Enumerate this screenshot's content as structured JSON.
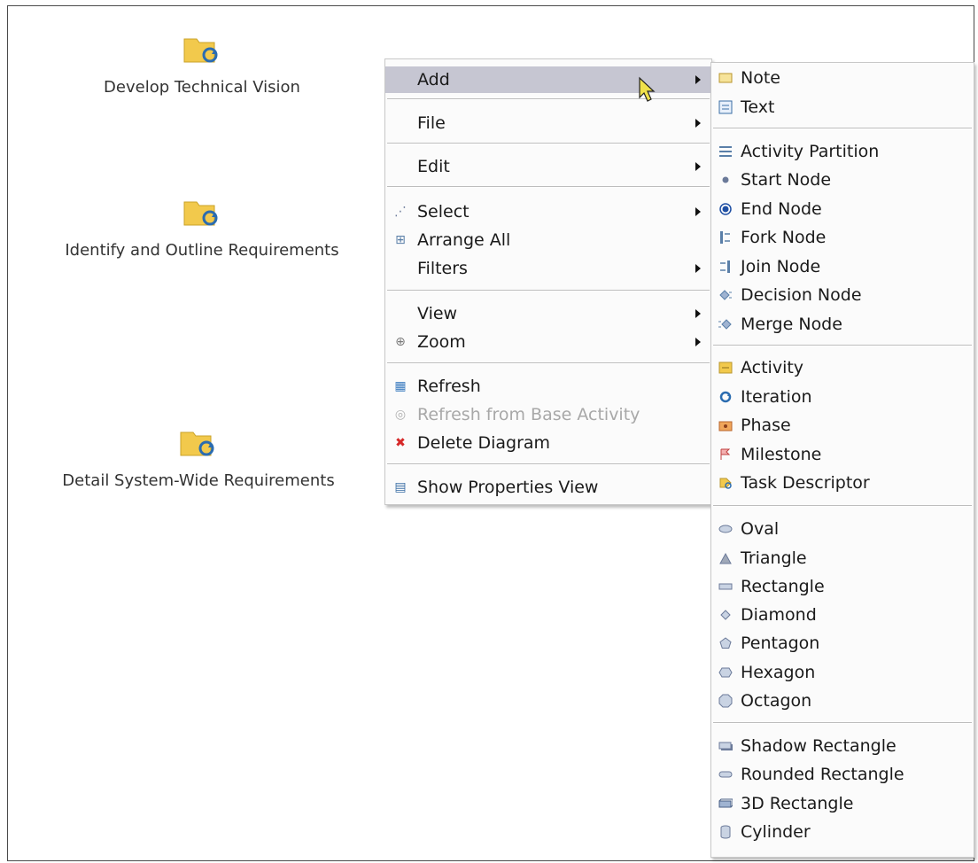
{
  "diagram": {
    "nodes": [
      {
        "label": "Develop Technical Vision",
        "icon": "activity-folder-icon"
      },
      {
        "label": "Identify and Outline Requirements",
        "icon": "activity-folder-icon"
      },
      {
        "label": "Detail System-Wide Requirements",
        "icon": "activity-folder-icon"
      }
    ]
  },
  "context_menu": {
    "items": [
      {
        "label": "Add",
        "icon": "",
        "submenu": true,
        "highlighted": true
      },
      {
        "label": "File",
        "icon": "",
        "submenu": true
      },
      {
        "label": "Edit",
        "icon": "",
        "submenu": true
      },
      {
        "label": "Select",
        "icon": "select-icon",
        "submenu": true
      },
      {
        "label": "Arrange All",
        "icon": "arrange-icon",
        "submenu": false
      },
      {
        "label": "Filters",
        "icon": "",
        "submenu": true
      },
      {
        "label": "View",
        "icon": "",
        "submenu": true
      },
      {
        "label": "Zoom",
        "icon": "zoom-icon",
        "submenu": true
      },
      {
        "label": "Refresh",
        "icon": "refresh-icon",
        "submenu": false
      },
      {
        "label": "Refresh from Base Activity",
        "icon": "refresh-base-icon",
        "submenu": false,
        "disabled": true
      },
      {
        "label": "Delete Diagram",
        "icon": "delete-icon",
        "submenu": false
      },
      {
        "label": "Show Properties View",
        "icon": "properties-icon",
        "submenu": false
      }
    ]
  },
  "add_submenu": {
    "items": [
      {
        "label": "Note",
        "icon": "note-icon"
      },
      {
        "label": "Text",
        "icon": "text-icon"
      },
      {
        "label": "Activity Partition",
        "icon": "partition-icon"
      },
      {
        "label": "Start Node",
        "icon": "start-node-icon"
      },
      {
        "label": "End Node",
        "icon": "end-node-icon"
      },
      {
        "label": "Fork Node",
        "icon": "fork-node-icon"
      },
      {
        "label": "Join Node",
        "icon": "join-node-icon"
      },
      {
        "label": "Decision Node",
        "icon": "decision-node-icon"
      },
      {
        "label": "Merge Node",
        "icon": "merge-node-icon"
      },
      {
        "label": "Activity",
        "icon": "activity-icon"
      },
      {
        "label": "Iteration",
        "icon": "iteration-icon"
      },
      {
        "label": "Phase",
        "icon": "phase-icon"
      },
      {
        "label": "Milestone",
        "icon": "milestone-icon"
      },
      {
        "label": "Task Descriptor",
        "icon": "task-descriptor-icon"
      },
      {
        "label": "Oval",
        "icon": "oval-icon"
      },
      {
        "label": "Triangle",
        "icon": "triangle-icon"
      },
      {
        "label": "Rectangle",
        "icon": "rectangle-icon"
      },
      {
        "label": "Diamond",
        "icon": "diamond-icon"
      },
      {
        "label": "Pentagon",
        "icon": "pentagon-icon"
      },
      {
        "label": "Hexagon",
        "icon": "hexagon-icon"
      },
      {
        "label": "Octagon",
        "icon": "octagon-icon"
      },
      {
        "label": "Shadow Rectangle",
        "icon": "shadow-rectangle-icon"
      },
      {
        "label": "Rounded Rectangle",
        "icon": "rounded-rectangle-icon"
      },
      {
        "label": "3D Rectangle",
        "icon": "3d-rectangle-icon"
      },
      {
        "label": "Cylinder",
        "icon": "cylinder-icon"
      }
    ]
  },
  "colors": {
    "highlight": "#c6c6d2",
    "folder": "#f2c94c",
    "refresh_arrow": "#2b6cb0",
    "delete": "#d62828"
  }
}
